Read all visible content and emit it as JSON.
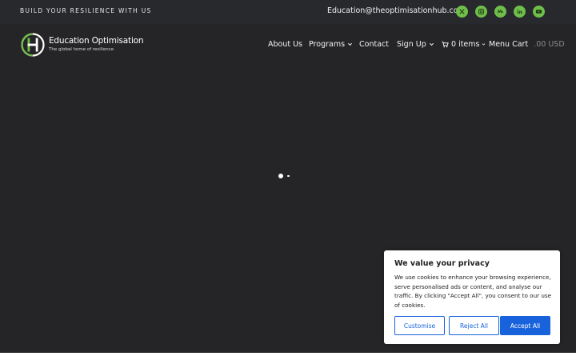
{
  "topbar": {
    "tagline": "BUILD YOUR RESILIENCE WITH US",
    "email": "Education@theoptimisationhub.com",
    "socials": [
      "x-icon",
      "instagram-icon",
      "meetup-icon",
      "linkedin-icon",
      "youtube-icon"
    ],
    "social_color": "#6fbf4a"
  },
  "brand": {
    "name": "Education Optimisation",
    "subtitle": "The global home of resilience",
    "logo_colors": [
      "#6fbf4a",
      "#ffffff"
    ]
  },
  "nav": {
    "about": "About Us",
    "programs": "Programs",
    "contact": "Contact",
    "signup": "Sign Up",
    "cart_items": "0 items",
    "menu_cart": "Menu Cart",
    "cart_price": ".00 USD"
  },
  "cookie_banner": {
    "title": "We value your privacy",
    "text": "We use cookies to enhance your browsing experience, serve personalised ads or content, and analyse our traffic. By clicking \"Accept All\", you consent to our use of cookies.",
    "customise": "Customise",
    "reject": "Reject All",
    "accept": "Accept All",
    "accent_color": "#1863dc"
  },
  "colors": {
    "background": "#252527",
    "topbar": "#28292c"
  }
}
